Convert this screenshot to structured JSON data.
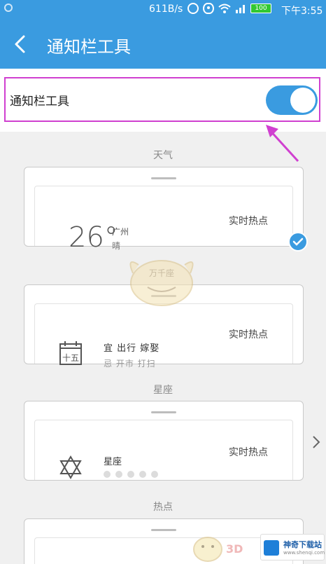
{
  "status_bar": {
    "net_speed": "611B/s",
    "battery": "100",
    "time": "下午3:55"
  },
  "app_bar": {
    "title": "通知栏工具",
    "back_icon": "chevron-left-icon"
  },
  "toggle": {
    "label": "通知栏工具",
    "state": "on"
  },
  "sections": {
    "weather_label": "天气",
    "horoscope_label": "星座",
    "hot_label": "热点"
  },
  "weather_card": {
    "temp": "26°",
    "city": "广州",
    "condition": "晴",
    "hot": "实时热点",
    "selected": true
  },
  "almanac_card": {
    "calendar_day": "十五",
    "good": "宜  出行  嫁娶",
    "bad": "忌  开市  打扫",
    "hot": "实时热点"
  },
  "horoscope_card": {
    "title": "星座",
    "rating": 5,
    "hot": "实时热点"
  },
  "watermark": {
    "mascot_text": "万千座",
    "brand": "神奇下载站",
    "brand_url": "www.shenqi.com",
    "site_mark": "3D"
  },
  "colors": {
    "primary": "#3a9be0",
    "highlight": "#d040d0"
  }
}
